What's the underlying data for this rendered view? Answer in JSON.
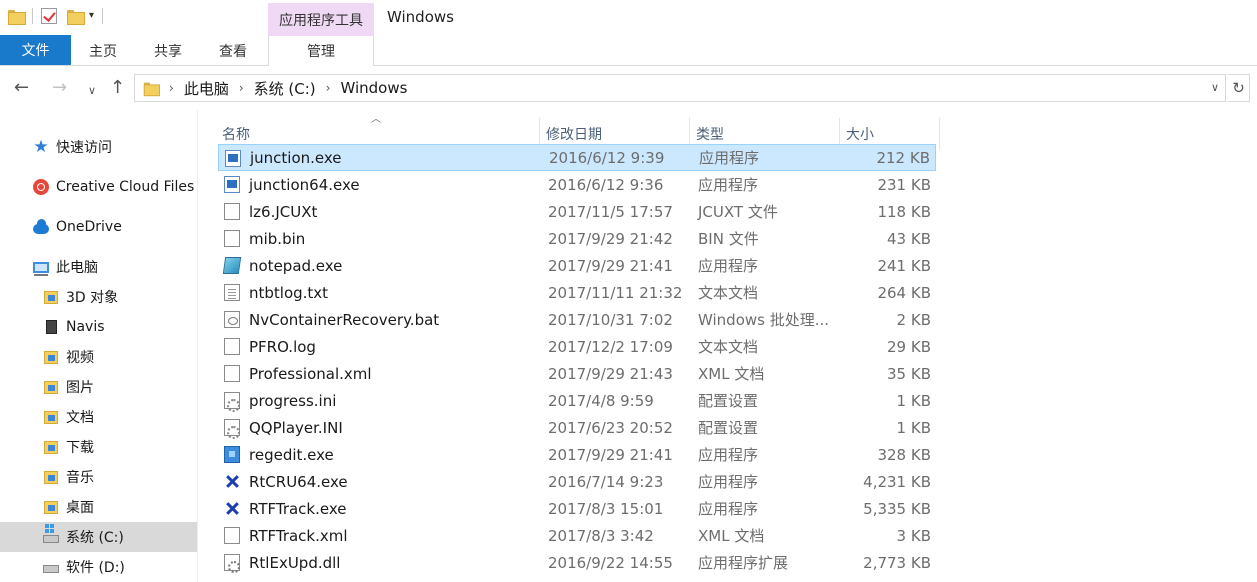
{
  "window": {
    "title": "Windows",
    "context_tab_group": "应用程序工具"
  },
  "ribbon": {
    "tabs": [
      "文件",
      "主页",
      "共享",
      "查看",
      "管理"
    ]
  },
  "address": {
    "crumbs": [
      "此电脑",
      "系统 (C:)",
      "Windows"
    ]
  },
  "navpane": {
    "items": [
      {
        "label": "快速访问",
        "icon": "quick-access-star-icon"
      },
      {
        "label": "Creative Cloud Files",
        "icon": "creative-cloud-icon"
      },
      {
        "label": "OneDrive",
        "icon": "onedrive-cloud-icon"
      },
      {
        "label": "此电脑",
        "icon": "this-pc-icon"
      },
      {
        "label": "3D 对象",
        "icon": "3d-objects-folder-icon"
      },
      {
        "label": "Navis",
        "icon": "navis-drive-icon"
      },
      {
        "label": "视频",
        "icon": "videos-folder-icon"
      },
      {
        "label": "图片",
        "icon": "pictures-folder-icon"
      },
      {
        "label": "文档",
        "icon": "documents-folder-icon"
      },
      {
        "label": "下载",
        "icon": "downloads-folder-icon"
      },
      {
        "label": "音乐",
        "icon": "music-folder-icon"
      },
      {
        "label": "桌面",
        "icon": "desktop-folder-icon"
      },
      {
        "label": "系统 (C:)",
        "icon": "system-drive-icon"
      },
      {
        "label": "软件 (D:)",
        "icon": "drive-icon"
      }
    ],
    "selected": "系统 (C:)"
  },
  "filelist": {
    "columns": [
      "名称",
      "修改日期",
      "类型",
      "大小"
    ],
    "sort_column": "名称",
    "rows": [
      {
        "name": "junction.exe",
        "date": "2016/6/12 9:39",
        "type": "应用程序",
        "size": "212 KB",
        "icon": "exe"
      },
      {
        "name": "junction64.exe",
        "date": "2016/6/12 9:36",
        "type": "应用程序",
        "size": "231 KB",
        "icon": "exe"
      },
      {
        "name": "lz6.JCUXt",
        "date": "2017/11/5 17:57",
        "type": "JCUXT 文件",
        "size": "118 KB",
        "icon": "doc"
      },
      {
        "name": "mib.bin",
        "date": "2017/9/29 21:42",
        "type": "BIN 文件",
        "size": "43 KB",
        "icon": "doc"
      },
      {
        "name": "notepad.exe",
        "date": "2017/9/29 21:41",
        "type": "应用程序",
        "size": "241 KB",
        "icon": "notepad"
      },
      {
        "name": "ntbtlog.txt",
        "date": "2017/11/11 21:32",
        "type": "文本文档",
        "size": "264 KB",
        "icon": "txt"
      },
      {
        "name": "NvContainerRecovery.bat",
        "date": "2017/10/31 7:02",
        "type": "Windows 批处理...",
        "size": "2 KB",
        "icon": "bat"
      },
      {
        "name": "PFRO.log",
        "date": "2017/12/2 17:09",
        "type": "文本文档",
        "size": "29 KB",
        "icon": "doc"
      },
      {
        "name": "Professional.xml",
        "date": "2017/9/29 21:43",
        "type": "XML 文档",
        "size": "35 KB",
        "icon": "doc"
      },
      {
        "name": "progress.ini",
        "date": "2017/4/8 9:59",
        "type": "配置设置",
        "size": "1 KB",
        "icon": "ini"
      },
      {
        "name": "QQPlayer.INI",
        "date": "2017/6/23 20:52",
        "type": "配置设置",
        "size": "1 KB",
        "icon": "ini"
      },
      {
        "name": "regedit.exe",
        "date": "2017/9/29 21:41",
        "type": "应用程序",
        "size": "328 KB",
        "icon": "regedit"
      },
      {
        "name": "RtCRU64.exe",
        "date": "2016/7/14 9:23",
        "type": "应用程序",
        "size": "4,231 KB",
        "icon": "cru"
      },
      {
        "name": "RTFTrack.exe",
        "date": "2017/8/3 15:01",
        "type": "应用程序",
        "size": "5,335 KB",
        "icon": "cru"
      },
      {
        "name": "RTFTrack.xml",
        "date": "2017/8/3 3:42",
        "type": "XML 文档",
        "size": "3 KB",
        "icon": "doc"
      },
      {
        "name": "RtlExUpd.dll",
        "date": "2016/9/22 14:55",
        "type": "应用程序扩展",
        "size": "2,773 KB",
        "icon": "dll"
      }
    ],
    "selected_row": "junction.exe"
  },
  "colors": {
    "file_tab_bg": "#1979ca",
    "context_tab_bg": "#f0d9f5",
    "selected_row_bg": "#cce8ff",
    "selected_row_border": "#99d1ff",
    "selected_nav_bg": "#d9d9d9",
    "column_header_text": "#4c607a"
  }
}
